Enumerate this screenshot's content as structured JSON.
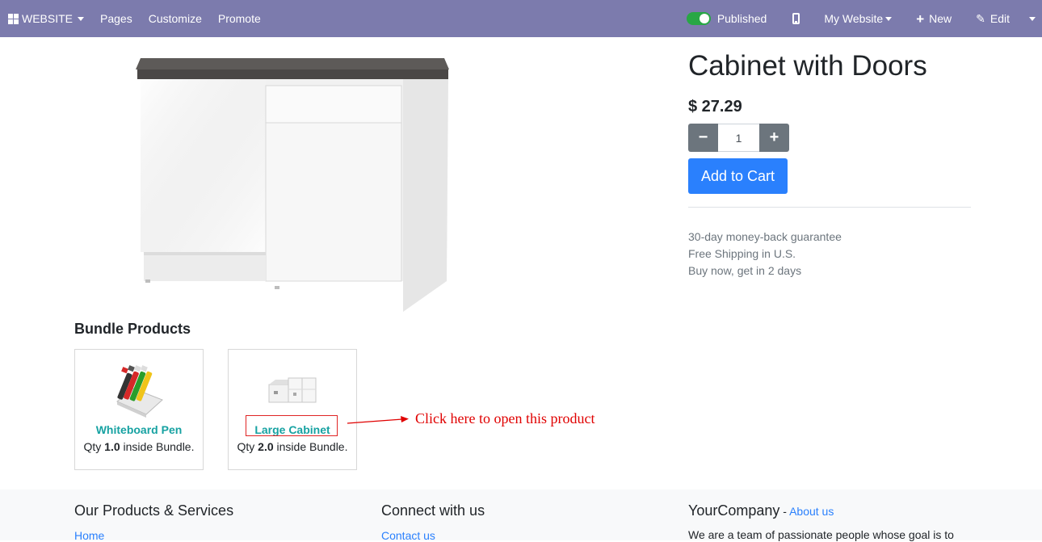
{
  "topbar": {
    "website_label": "WEBSITE",
    "pages_label": "Pages",
    "customize_label": "Customize",
    "promote_label": "Promote",
    "published_label": "Published",
    "my_website_label": "My Website",
    "new_label": "New",
    "edit_label": "Edit",
    "bar_color": "#7c7bad",
    "toggle_color": "#28a745"
  },
  "product": {
    "title": "Cabinet with Doors",
    "price": "$ 27.29",
    "quantity": "1",
    "add_to_cart_label": "Add to Cart",
    "perks": [
      "30-day money-back guarantee",
      "Free Shipping in U.S.",
      "Buy now, get in 2 days"
    ]
  },
  "bundle": {
    "heading": "Bundle Products",
    "items": [
      {
        "name": "Whiteboard Pen",
        "qty_prefix": "Qty ",
        "qty": "1.0",
        "qty_suffix": " inside Bundle."
      },
      {
        "name": "Large Cabinet",
        "qty_prefix": "Qty ",
        "qty": "2.0",
        "qty_suffix": " inside Bundle."
      }
    ]
  },
  "annotation": {
    "text": "Click here to open this product",
    "color": "#e00000"
  },
  "footer": {
    "col1_title": "Our Products & Services",
    "col1_link": "Home",
    "col2_title": "Connect with us",
    "col2_link": "Contact us",
    "col3_title": "YourCompany",
    "col3_sep": " - ",
    "col3_about": "About us",
    "col3_text": "We are a team of passionate people whose goal is to"
  }
}
